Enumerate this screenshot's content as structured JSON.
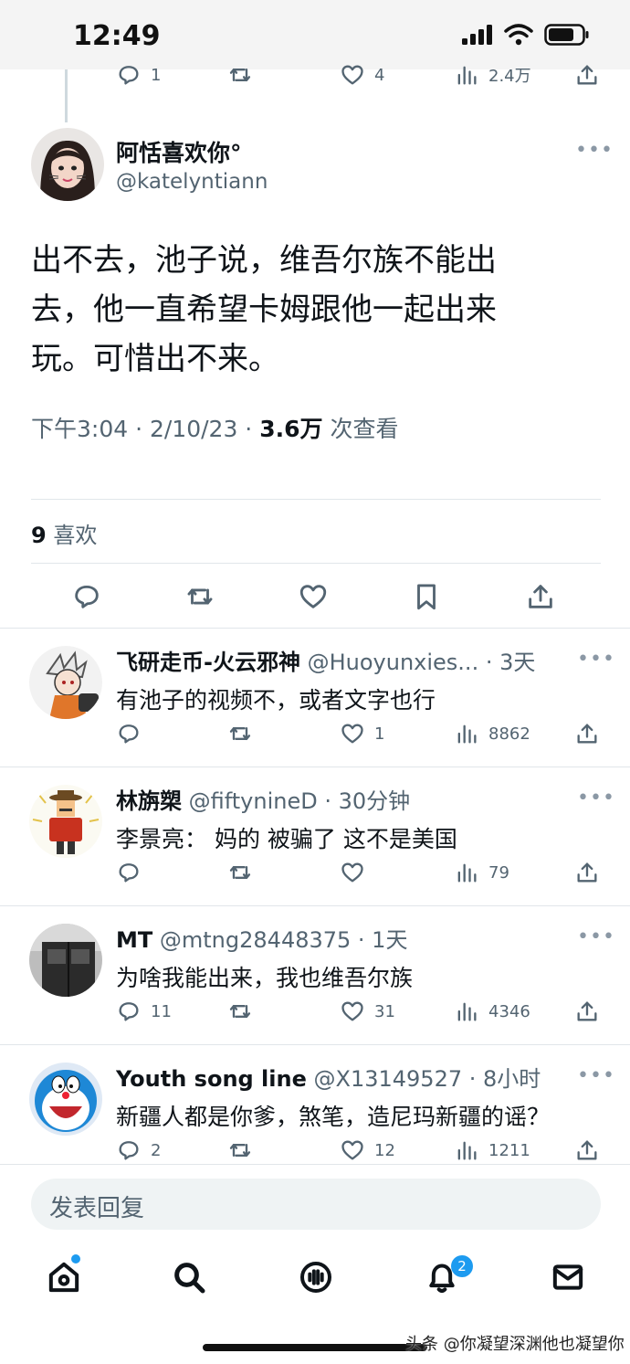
{
  "status": {
    "time": "12:49"
  },
  "prev_actions": {
    "replies": "1",
    "likes": "4",
    "views": "2.4万"
  },
  "main": {
    "name": "阿恬喜欢你°",
    "handle": "@katelyntiann",
    "lines": [
      "出不去，池子说，维吾尔族不能出",
      "去，他一直希望卡姆跟他一起出来",
      "玩。可惜出不来。"
    ],
    "meta_time": "下午3:04 · 2/10/23 · ",
    "meta_views": "3.6万",
    "meta_views_label": " 次查看",
    "likes_count": "9",
    "likes_label": " 喜欢",
    "more": "•••"
  },
  "replies": [
    {
      "name": "飞研走币-火云邪神",
      "handle": " @Huoyunxies... · 3天",
      "text": "有池子的视频不，或者文字也行",
      "replies": "",
      "likes": "1",
      "views": "8862"
    },
    {
      "name": "林旃槊",
      "handle": " @fiftynineD · 30分钟",
      "text": "李景亮：  妈的 被骗了 这不是美国",
      "replies": "",
      "likes": "",
      "views": "79"
    },
    {
      "name": "MT",
      "handle": " @mtng28448375 · 1天",
      "text": "为啥我能出来，我也维吾尔族",
      "replies": "11",
      "likes": "31",
      "views": "4346"
    },
    {
      "name": "Youth song line",
      "handle": " @X13149527 · 8小时",
      "text": "新疆人都是你爹，煞笔，造尼玛新疆的谣？",
      "replies": "2",
      "likes": "12",
      "views": "1211"
    }
  ],
  "compose": {
    "placeholder": "发表回复"
  },
  "tabs": {
    "notifications_badge": "2"
  },
  "watermark": "头条 @你凝望深渊他也凝望你",
  "colors": {
    "accent": "#1d9bf0",
    "secondary_text": "#536471",
    "divider": "#e1e6ea"
  }
}
